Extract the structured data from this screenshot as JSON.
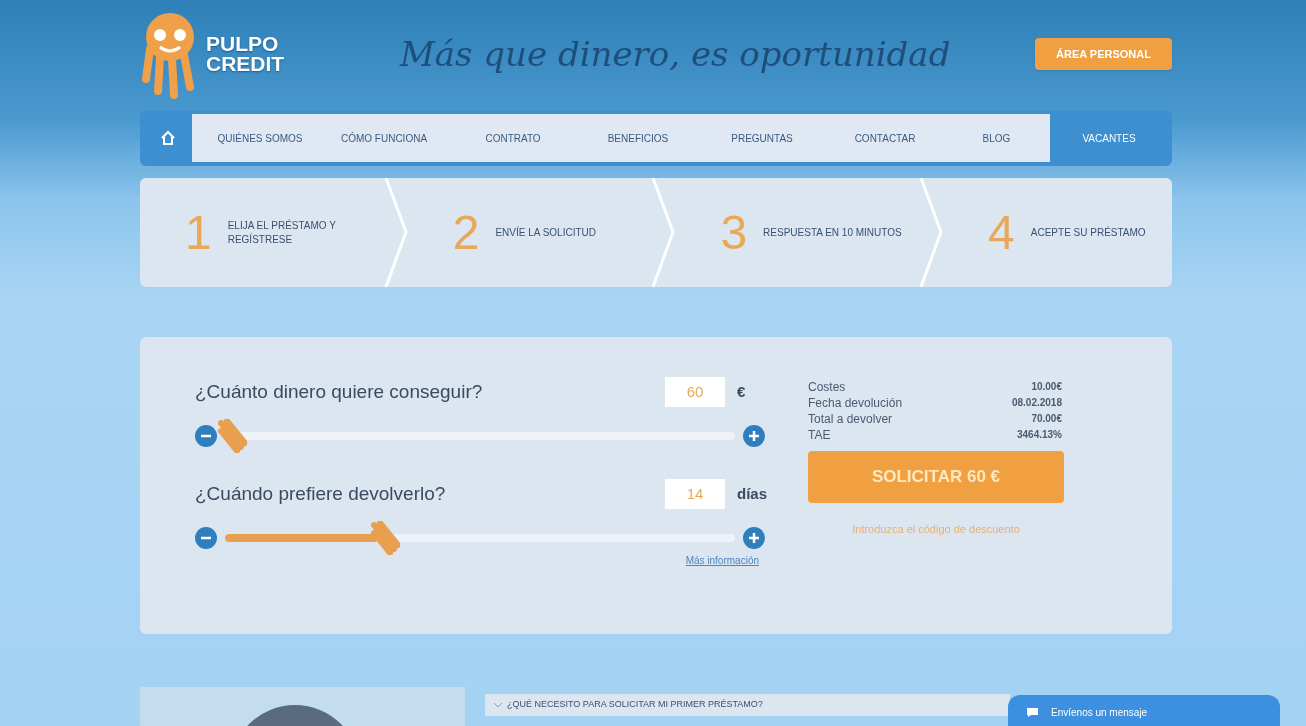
{
  "header": {
    "logo": "PULPO CREDIT",
    "tagline": "Más que dinero, es oportunidad",
    "account_button": "ÁREA PERSONAL"
  },
  "nav": {
    "items": [
      {
        "label": "QUIÉNES SOMOS",
        "selected": false
      },
      {
        "label": "CÓMO FUNCIONA",
        "selected": false
      },
      {
        "label": "CONTRATO",
        "selected": false
      },
      {
        "label": "BENEFICIOS",
        "selected": false
      },
      {
        "label": "PREGUNTAS",
        "selected": false
      },
      {
        "label": "CONTACTAR",
        "selected": false
      },
      {
        "label": "BLOG",
        "selected": false
      },
      {
        "label": "VACANTES",
        "selected": true
      }
    ]
  },
  "steps": [
    {
      "number": "1",
      "label": "ELIJA EL PRÉSTAMO Y REGÍSTRESE"
    },
    {
      "number": "2",
      "label": "ENVÍE LA SOLICITUD"
    },
    {
      "number": "3",
      "label": "RESPUESTA EN 10 MINUTOS"
    },
    {
      "number": "4",
      "label": "ACEPTE SU PRÉSTAMO"
    }
  ],
  "calculator": {
    "sliders": [
      {
        "question": "¿Cuánto dinero quiere conseguir?",
        "value": "60",
        "unit": "€",
        "level": 0.0
      },
      {
        "question": "¿Cuándo prefiere devolverlo?",
        "value": "14",
        "unit": "días",
        "level": 0.3
      }
    ],
    "more_info_link": "Más información",
    "summary": [
      {
        "label": "Costes",
        "value": "10.00€"
      },
      {
        "label": "Fecha devolución",
        "value": "08.02.2018"
      },
      {
        "label": "Total a devolver",
        "value": "70.00€"
      },
      {
        "label": "TAE",
        "value": "3464.13%"
      }
    ],
    "submit_button": "SOLICITAR 60 €",
    "discount_link": "Introduzca el código de descuento"
  },
  "faq": {
    "question": "¿QUÉ NECESITO PARA SOLICITAR MI PRIMER PRÉSTAMO?"
  },
  "chat_button": "Envíenos un mensaje"
}
